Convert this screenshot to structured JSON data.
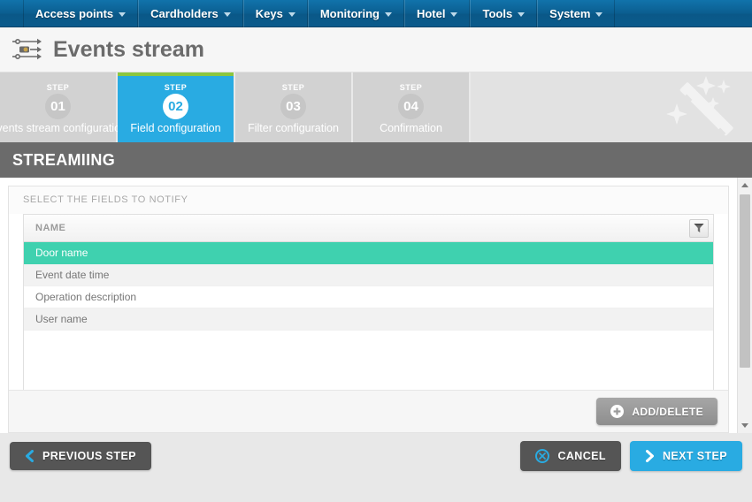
{
  "navbar": {
    "items": [
      {
        "label": "Access points",
        "icon": "chevron-down-icon"
      },
      {
        "label": "Cardholders",
        "icon": "chevron-down-icon"
      },
      {
        "label": "Keys",
        "icon": "chevron-down-icon"
      },
      {
        "label": "Monitoring",
        "icon": "chevron-down-icon"
      },
      {
        "label": "Hotel",
        "icon": "chevron-down-icon"
      },
      {
        "label": "Tools",
        "icon": "chevron-down-icon"
      },
      {
        "label": "System",
        "icon": "chevron-down-icon"
      }
    ]
  },
  "page": {
    "title": "Events stream",
    "icon": "events-stream-icon",
    "decor_icon": "magic-wand-icon"
  },
  "wizard": {
    "steps": [
      {
        "step_label": "STEP",
        "number": "01",
        "name": "Events stream configuration",
        "active": false
      },
      {
        "step_label": "STEP",
        "number": "02",
        "name": "Field configuration",
        "active": true
      },
      {
        "step_label": "STEP",
        "number": "03",
        "name": "Filter configuration",
        "active": false
      },
      {
        "step_label": "STEP",
        "number": "04",
        "name": "Confirmation",
        "active": false
      }
    ],
    "active_accent_color": "#8cc63f",
    "active_color": "#29abe2"
  },
  "section": {
    "title": "STREAMIING"
  },
  "panel": {
    "caption": "SELECT THE FIELDS TO NOTIFY",
    "table": {
      "columns": [
        "NAME"
      ],
      "filter_icon": "funnel-filter-icon",
      "rows": [
        {
          "name": "Door name",
          "selected": true
        },
        {
          "name": "Event date time",
          "selected": false
        },
        {
          "name": "Operation description",
          "selected": false
        },
        {
          "name": "User name",
          "selected": false
        }
      ],
      "selected_color": "#3fd1af"
    },
    "add_delete_button": {
      "label": "ADD/DELETE",
      "icon": "plus-circle-icon"
    }
  },
  "footer": {
    "previous": {
      "label": "PREVIOUS STEP",
      "icon": "chevron-left-icon"
    },
    "cancel": {
      "label": "CANCEL",
      "icon": "cancel-circle-icon"
    },
    "next": {
      "label": "NEXT STEP",
      "icon": "chevron-right-icon"
    }
  },
  "scrollbar": {
    "up_icon": "scroll-up-arrow-icon",
    "down_icon": "scroll-down-arrow-icon"
  }
}
